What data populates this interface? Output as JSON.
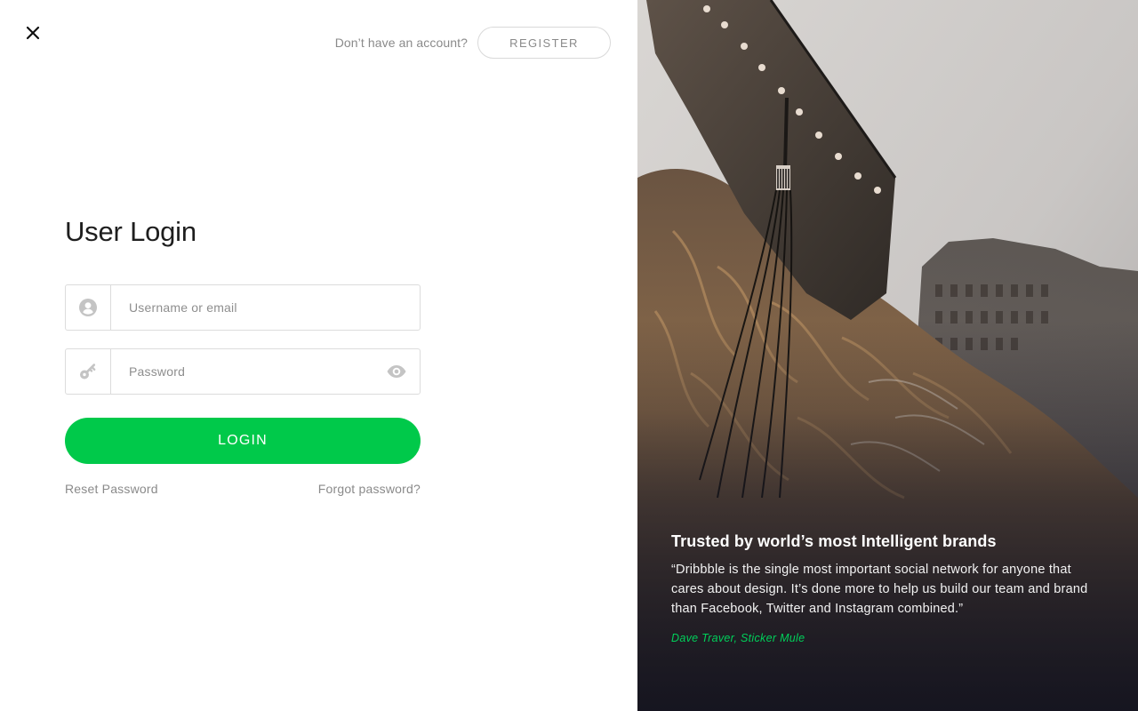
{
  "header": {
    "close_icon": "close-icon",
    "account_prompt": "Don’t have an account?",
    "register_label": "REGISTER"
  },
  "login": {
    "title": "User Login",
    "username": {
      "placeholder": "Username or email",
      "value": "",
      "icon": "user-circle-icon"
    },
    "password": {
      "placeholder": "Password",
      "value": "",
      "icon": "key-icon",
      "toggle_icon": "eye-icon"
    },
    "submit_label": "LOGIN",
    "reset_link": "Reset Password",
    "forgot_link": "Forgot password?"
  },
  "testimonial": {
    "title": "Trusted by world’s most Intelligent brands",
    "quote": "“Dribbble is the single most important social network for anyone that cares about design. It’s done more to help us build our team and brand than Facebook, Twitter and Instagram combined.”",
    "author": "Dave Traver, Sticker Mule"
  },
  "colors": {
    "accent": "#00c94a",
    "author": "#00d05a",
    "muted_text": "#8a8a8a",
    "border": "#dcdcdc"
  }
}
